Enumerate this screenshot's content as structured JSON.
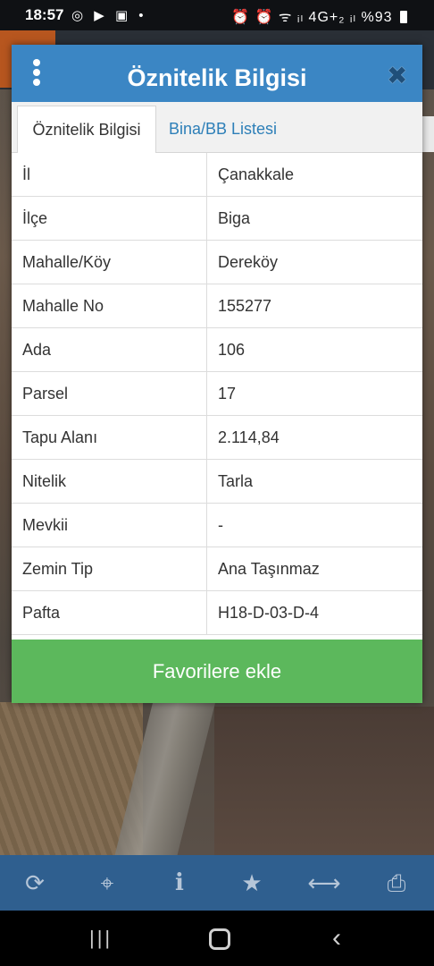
{
  "status_bar": {
    "time": "18:57",
    "apps": "◎ ▶ ▣ •",
    "right_icons": "⏰ ⏰ ᯤ ᵢₗ 4G+₂ ᵢₗ",
    "battery": "%93"
  },
  "dialog": {
    "title": "Öznitelik Bilgisi",
    "tabs": [
      {
        "label": "Öznitelik Bilgisi",
        "active": true
      },
      {
        "label": "Bina/BB Listesi",
        "active": false
      }
    ],
    "rows": [
      {
        "key": "İl",
        "value": "Çanakkale"
      },
      {
        "key": "İlçe",
        "value": "Biga"
      },
      {
        "key": "Mahalle/Köy",
        "value": "Dereköy"
      },
      {
        "key": "Mahalle No",
        "value": "155277"
      },
      {
        "key": "Ada",
        "value": "106"
      },
      {
        "key": "Parsel",
        "value": "17"
      },
      {
        "key": "Tapu Alanı",
        "value": "2.114,84"
      },
      {
        "key": "Nitelik",
        "value": "Tarla"
      },
      {
        "key": "Mevkii",
        "value": "-"
      },
      {
        "key": "Zemin Tip",
        "value": "Ana Taşınmaz"
      },
      {
        "key": "Pafta",
        "value": "H18-D-03-D-4"
      }
    ],
    "favorite_button": "Favorilere ekle",
    "colors": {
      "header": "#3b86c4",
      "button": "#5cb85c",
      "tab_link": "#2d7fb8"
    }
  },
  "toolbar": {
    "icons": [
      "refresh-icon",
      "crosshair-icon",
      "info-icon",
      "star-icon",
      "measure-icon",
      "print-icon"
    ],
    "glyphs": [
      "⟳",
      "⌖",
      "i",
      "★",
      "⟷",
      "⎙"
    ]
  },
  "navbar": {
    "recents": "|||",
    "back": "‹"
  }
}
